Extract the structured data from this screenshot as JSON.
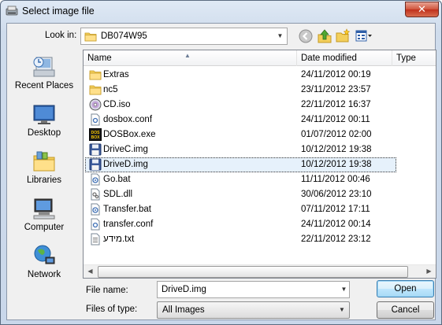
{
  "window": {
    "title": "Select image file",
    "close_label": "✕"
  },
  "toolbar": {
    "lookin_label": "Look in:",
    "lookin_value": "DB074W95",
    "back_icon": "back-icon",
    "up_icon": "up-folder-icon",
    "newfolder_icon": "new-folder-icon",
    "views_icon": "views-menu-icon"
  },
  "places": [
    {
      "label": "Recent Places",
      "icon": "recent-places-icon"
    },
    {
      "label": "Desktop",
      "icon": "desktop-icon"
    },
    {
      "label": "Libraries",
      "icon": "libraries-icon"
    },
    {
      "label": "Computer",
      "icon": "computer-icon"
    },
    {
      "label": "Network",
      "icon": "network-icon"
    }
  ],
  "columns": {
    "name": "Name",
    "date": "Date modified",
    "type": "Type"
  },
  "files": [
    {
      "name": "Extras",
      "date": "24/11/2012 00:19",
      "icon": "folder-icon"
    },
    {
      "name": "nc5",
      "date": "23/11/2012 23:57",
      "icon": "folder-icon"
    },
    {
      "name": "CD.iso",
      "date": "22/11/2012 16:37",
      "icon": "disc-icon"
    },
    {
      "name": "dosbox.conf",
      "date": "24/11/2012 00:11",
      "icon": "config-file-icon"
    },
    {
      "name": "DOSBox.exe",
      "date": "01/07/2012 02:00",
      "icon": "dosbox-icon"
    },
    {
      "name": "DriveC.img",
      "date": "10/12/2012 19:38",
      "icon": "floppy-icon"
    },
    {
      "name": "DriveD.img",
      "date": "10/12/2012 19:38",
      "icon": "floppy-icon",
      "selected": true
    },
    {
      "name": "Go.bat",
      "date": "11/11/2012 00:46",
      "icon": "batch-file-icon"
    },
    {
      "name": "SDL.dll",
      "date": "30/06/2012 23:10",
      "icon": "dll-file-icon"
    },
    {
      "name": "Transfer.bat",
      "date": "07/11/2012 17:11",
      "icon": "batch-file-icon"
    },
    {
      "name": "transfer.conf",
      "date": "24/11/2012 00:14",
      "icon": "config-file-icon"
    },
    {
      "name": "מידע.txt",
      "date": "22/11/2012 23:12",
      "icon": "text-file-icon"
    }
  ],
  "form": {
    "filename_label": "File name:",
    "filename_value": "DriveD.img",
    "filetype_label": "Files of type:",
    "filetype_value": "All Images",
    "open_label": "Open",
    "cancel_label": "Cancel"
  },
  "colors": {
    "title_gradient": "#dfe9f5",
    "close_red": "#c0301c",
    "selection": "#e6f1fb",
    "open_border": "#3c7fb1"
  }
}
